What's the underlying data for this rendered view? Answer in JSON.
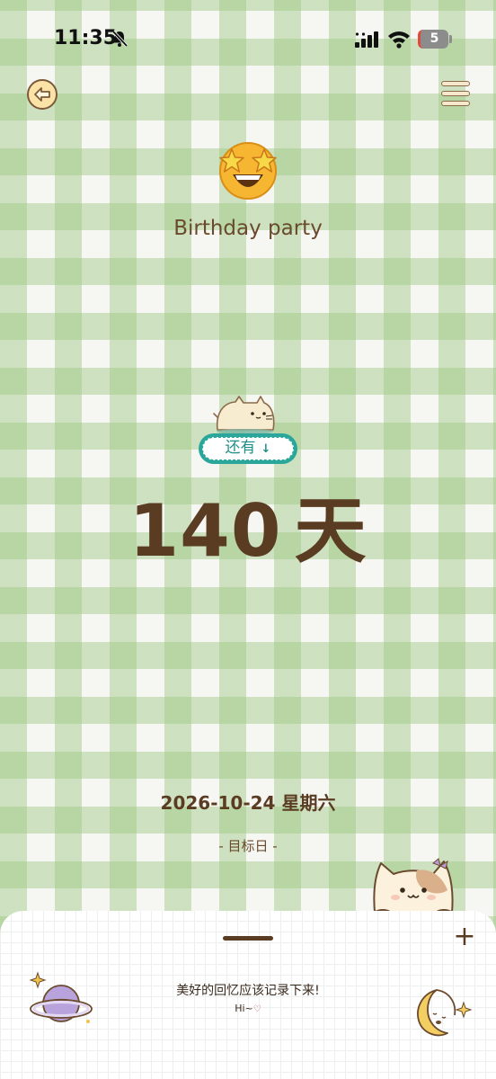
{
  "status_bar": {
    "time": "11:35",
    "battery": "5",
    "icons": [
      "bell-slash-icon",
      "signal-icon",
      "wifi-icon",
      "battery-icon"
    ]
  },
  "nav": {
    "back_icon": "arrow-left-icon",
    "menu_icon": "menu-icon"
  },
  "event": {
    "emoji_icon": "star-struck-emoji-icon",
    "title": "Birthday party"
  },
  "countdown": {
    "badge_label": "还有",
    "badge_icon": "arrow-down-icon",
    "days_value": "140",
    "days_unit": "天"
  },
  "date": {
    "value": "2026-10-24 星期六",
    "label": "- 目标日 -"
  },
  "sheet": {
    "message": "美好的回忆应该记录下来!",
    "greeting": "Hi~",
    "add_icon": "plus-icon"
  },
  "colors": {
    "check_green": "#9cc882",
    "text_brown": "#5a3c22",
    "badge_teal": "#2aa79a"
  }
}
